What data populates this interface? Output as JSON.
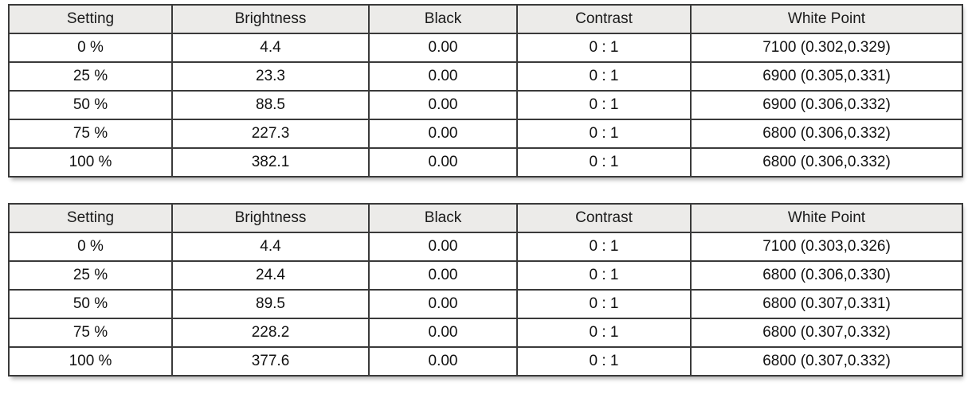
{
  "tables": [
    {
      "name": "measurement-table-1",
      "columns": [
        "Setting",
        "Brightness",
        "Black",
        "Contrast",
        "White Point"
      ],
      "rows": [
        [
          "0 %",
          "4.4",
          "0.00",
          "0 : 1",
          "7100 (0.302,0.329)"
        ],
        [
          "25 %",
          "23.3",
          "0.00",
          "0 : 1",
          "6900 (0.305,0.331)"
        ],
        [
          "50 %",
          "88.5",
          "0.00",
          "0 : 1",
          "6900 (0.306,0.332)"
        ],
        [
          "75 %",
          "227.3",
          "0.00",
          "0 : 1",
          "6800 (0.306,0.332)"
        ],
        [
          "100 %",
          "382.1",
          "0.00",
          "0 : 1",
          "6800 (0.306,0.332)"
        ]
      ]
    },
    {
      "name": "measurement-table-2",
      "columns": [
        "Setting",
        "Brightness",
        "Black",
        "Contrast",
        "White Point"
      ],
      "rows": [
        [
          "0 %",
          "4.4",
          "0.00",
          "0 : 1",
          "7100 (0.303,0.326)"
        ],
        [
          "25 %",
          "24.4",
          "0.00",
          "0 : 1",
          "6800 (0.306,0.330)"
        ],
        [
          "50 %",
          "89.5",
          "0.00",
          "0 : 1",
          "6800 (0.307,0.331)"
        ],
        [
          "75 %",
          "228.2",
          "0.00",
          "0 : 1",
          "6800 (0.307,0.332)"
        ],
        [
          "100 %",
          "377.6",
          "0.00",
          "0 : 1",
          "6800 (0.307,0.332)"
        ]
      ]
    }
  ],
  "colors": {
    "header_background": "#ecebe9",
    "cell_background": "#ffffff",
    "border": "#3a3a3a",
    "text": "#111111",
    "page_background": "#ffffff"
  }
}
